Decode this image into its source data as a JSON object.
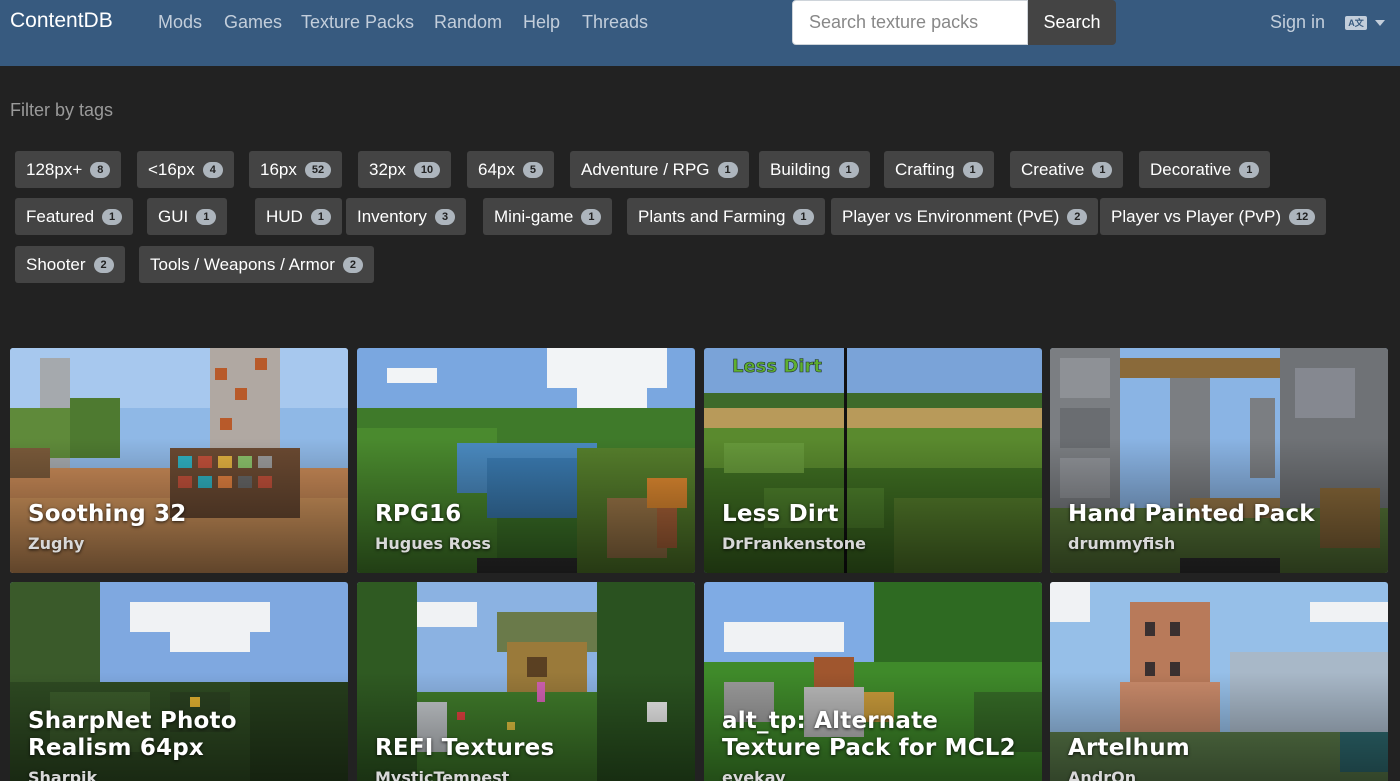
{
  "nav": {
    "brand": "ContentDB",
    "links": [
      "Mods",
      "Games",
      "Texture Packs",
      "Random",
      "Help",
      "Threads"
    ],
    "search_placeholder": "Search texture packs",
    "search_button": "Search",
    "signin": "Sign in",
    "language_icon": "language-icon"
  },
  "filter": {
    "title": "Filter by tags",
    "tags": [
      {
        "label": "128px+",
        "count": "8"
      },
      {
        "label": "<16px",
        "count": "4"
      },
      {
        "label": "16px",
        "count": "52"
      },
      {
        "label": "32px",
        "count": "10"
      },
      {
        "label": "64px",
        "count": "5"
      },
      {
        "label": "Adventure / RPG",
        "count": "1"
      },
      {
        "label": "Building",
        "count": "1"
      },
      {
        "label": "Crafting",
        "count": "1"
      },
      {
        "label": "Creative",
        "count": "1"
      },
      {
        "label": "Decorative",
        "count": "1"
      },
      {
        "label": "Featured",
        "count": "1"
      },
      {
        "label": "GUI",
        "count": "1"
      },
      {
        "label": "HUD",
        "count": "1"
      },
      {
        "label": "Inventory",
        "count": "3"
      },
      {
        "label": "Mini-game",
        "count": "1"
      },
      {
        "label": "Plants and Farming",
        "count": "1"
      },
      {
        "label": "Player vs Environment (PvE)",
        "count": "2"
      },
      {
        "label": "Player vs Player (PvP)",
        "count": "12"
      },
      {
        "label": "Shooter",
        "count": "2"
      },
      {
        "label": "Tools / Weapons / Armor",
        "count": "2"
      }
    ]
  },
  "packages": [
    {
      "title": "Soothing 32",
      "author": "Zughy"
    },
    {
      "title": "RPG16",
      "author": "Hugues Ross"
    },
    {
      "title": "Less Dirt",
      "author": "DrFrankenstone",
      "overlay": "Less Dirt"
    },
    {
      "title": "Hand Painted Pack",
      "author": "drummyfish"
    },
    {
      "title": "SharpNet Photo Realism 64px",
      "author": "Sharpik"
    },
    {
      "title": "REFI Textures",
      "author": "MysticTempest"
    },
    {
      "title": "alt_tp: Alternate Texture Pack for MCL2",
      "author": "eyekay"
    },
    {
      "title": "Artelhum",
      "author": "AndrOn"
    }
  ]
}
